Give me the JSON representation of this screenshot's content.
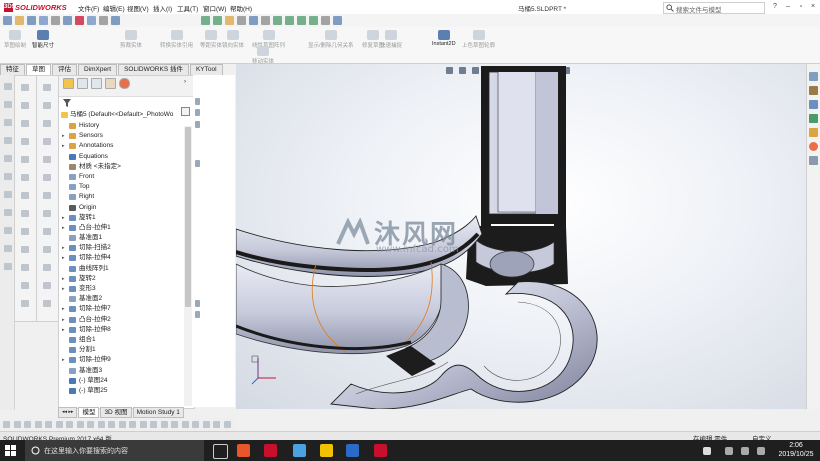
{
  "app": {
    "brand": "SOLIDWORKS",
    "brand_prefix": "3DS",
    "document_title": "马桶5.SLDPRT *",
    "search_placeholder": "搜索文件与模型"
  },
  "menu": [
    "文件(F)",
    "编辑(E)",
    "视图(V)",
    "插入(I)",
    "工具(T)",
    "窗口(W)",
    "帮助(H)"
  ],
  "command_manager": {
    "items": [
      "草图绘制",
      "智能尺寸",
      "剪裁实体",
      "转换实体引用",
      "等距实体",
      "镜向实体",
      "线性草图阵列",
      "移动实体",
      "显示/删除几何关系",
      "修复草图",
      "快速捕捉",
      "Instant2D",
      "上色草图轮廓"
    ]
  },
  "tabs": [
    "特征",
    "草图",
    "评估",
    "DimXpert",
    "SOLIDWORKS 插件",
    "KYTool"
  ],
  "active_tab": "草图",
  "tree": {
    "root": "马桶5 (Default<<Default>_PhotoWo",
    "items": [
      {
        "label": "History",
        "icon": "history-icon",
        "color": "#d9a441"
      },
      {
        "label": "Sensors",
        "icon": "sensor-icon",
        "color": "#d9a441"
      },
      {
        "label": "Annotations",
        "icon": "annotation-icon",
        "color": "#d9a441"
      },
      {
        "label": "Equations",
        "icon": "equation-icon",
        "color": "#4a78b8"
      },
      {
        "label": "材质 <未指定>",
        "icon": "material-icon",
        "color": "#9a8a6a"
      },
      {
        "label": "Front",
        "icon": "plane-icon",
        "color": "#8aa0c0"
      },
      {
        "label": "Top",
        "icon": "plane-icon",
        "color": "#8aa0c0"
      },
      {
        "label": "Right",
        "icon": "plane-icon",
        "color": "#8aa0c0"
      },
      {
        "label": "Origin",
        "icon": "origin-icon",
        "color": "#5a5a5a"
      },
      {
        "label": "旋转1",
        "icon": "revolve-icon",
        "color": "#6b8fbf"
      },
      {
        "label": "凸台-拉伸1",
        "icon": "extrude-icon",
        "color": "#6b8fbf"
      },
      {
        "label": "基准面1",
        "icon": "plane-icon",
        "color": "#8aa0c0"
      },
      {
        "label": "切除-扫描2",
        "icon": "sweep-cut-icon",
        "color": "#6b8fbf"
      },
      {
        "label": "切除-拉伸4",
        "icon": "extrude-cut-icon",
        "color": "#6b8fbf"
      },
      {
        "label": "曲线阵列1",
        "icon": "pattern-icon",
        "color": "#6b8fbf"
      },
      {
        "label": "旋转2",
        "icon": "revolve-icon",
        "color": "#6b8fbf"
      },
      {
        "label": "变形3",
        "icon": "deform-icon",
        "color": "#6b8fbf"
      },
      {
        "label": "基准面2",
        "icon": "plane-icon",
        "color": "#8aa0c0"
      },
      {
        "label": "切除-拉伸7",
        "icon": "extrude-cut-icon",
        "color": "#6b8fbf"
      },
      {
        "label": "凸台-拉伸2",
        "icon": "extrude-icon",
        "color": "#6b8fbf"
      },
      {
        "label": "切除-拉伸8",
        "icon": "extrude-cut-icon",
        "color": "#6b8fbf"
      },
      {
        "label": "组合1",
        "icon": "combine-icon",
        "color": "#6b8fbf"
      },
      {
        "label": "分割1",
        "icon": "split-icon",
        "color": "#6b8fbf"
      },
      {
        "label": "切除-拉伸9",
        "icon": "extrude-cut-icon",
        "color": "#6b8fbf"
      },
      {
        "label": "基准面3",
        "icon": "plane-icon",
        "color": "#8aa0c0"
      },
      {
        "label": "(-) 草图24",
        "icon": "sketch-icon",
        "color": "#4a78b8"
      },
      {
        "label": "(-) 草图25",
        "icon": "sketch-icon",
        "color": "#4a78b8"
      }
    ],
    "expandable": [
      false,
      true,
      true,
      false,
      false,
      false,
      false,
      false,
      false,
      true,
      true,
      false,
      true,
      true,
      false,
      true,
      true,
      false,
      true,
      true,
      true,
      false,
      false,
      true,
      false,
      false,
      false
    ]
  },
  "bottom_tabs": [
    "模型",
    "3D 视图",
    "Motion Study 1"
  ],
  "status": {
    "product": "SOLIDWORKS Premium 2017 x64 版",
    "editing": "在编辑 零件",
    "units": "自定义"
  },
  "taskbar": {
    "search_placeholder": "在这里输入你要搜索的内容",
    "time": "2:06",
    "date": "2019/10/25"
  },
  "watermark": {
    "text": "沐风网",
    "url": "www.mfcad.com"
  },
  "colors": {
    "brand_red": "#c8102e",
    "model_body": "#c9ccdc",
    "model_dark": "#1a1a1a",
    "edge_orange": "#e07b1a",
    "taskbar": "#1f1f1f"
  }
}
